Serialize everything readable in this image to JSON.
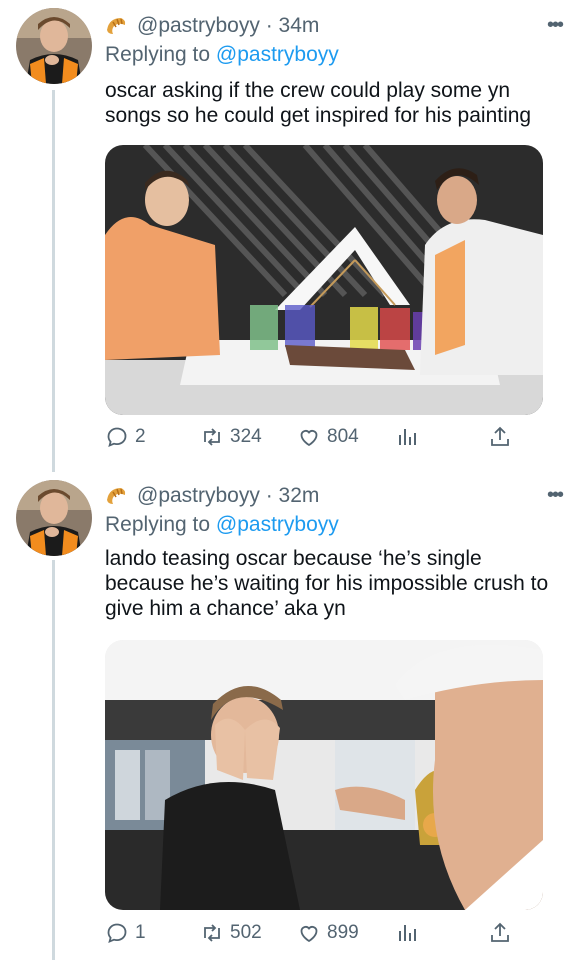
{
  "colors": {
    "text": "#0f1419",
    "secondary": "#536471",
    "link": "#1d9bf0",
    "thread_line": "#cfd9de"
  },
  "tweets": [
    {
      "handle": "@pastryboyy",
      "time": "34m",
      "replying_prefix": "Replying to",
      "replying_to": "@pastryboyy",
      "text": "oscar asking if the crew could play some yn songs so he could get inspired for his painting",
      "media_icon": "photo-painting-scene",
      "stats": {
        "replies": "2",
        "retweets": "324",
        "likes": "804"
      }
    },
    {
      "handle": "@pastryboyy",
      "time": "32m",
      "replying_prefix": "Replying to",
      "replying_to": "@pastryboyy",
      "text": "lando teasing oscar because ‘he’s single because he’s waiting for his impossible crush to give him a chance’ aka yn",
      "media_icon": "photo-facepalm-scene",
      "stats": {
        "replies": "1",
        "retweets": "502",
        "likes": "899"
      }
    }
  ]
}
